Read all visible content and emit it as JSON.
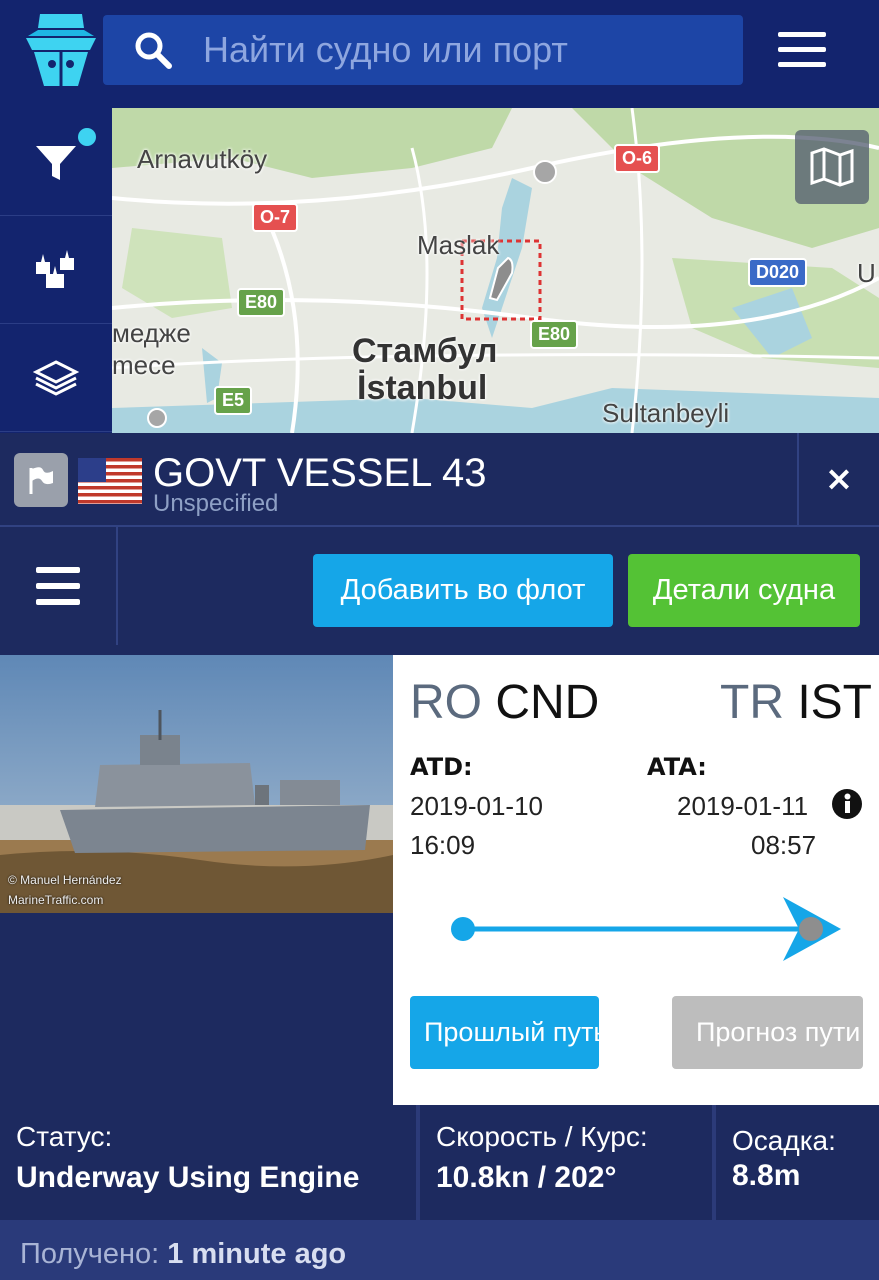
{
  "header": {
    "search_placeholder": "Найти судно или порт"
  },
  "map": {
    "labels": {
      "arnavutkoy": "Arnavutköy",
      "maslak": "Maslak",
      "istanbul_ru": "Стамбул",
      "istanbul": "İstanbul",
      "medzhe": "медже",
      "mece": "mece",
      "sultanbeyli": "Sultanbeyli",
      "u": "U"
    },
    "road_shields": {
      "o6a": "O-6",
      "o6b": "O-6",
      "o7": "O-7",
      "e80a": "E80",
      "e80b": "E80",
      "e5": "E5",
      "d020": "D020"
    }
  },
  "vessel": {
    "name": "GOVT VESSEL 43",
    "type": "Unspecified",
    "close": "×"
  },
  "actions": {
    "add_to_fleet": "Добавить во флот",
    "vessel_details": "Детали судна"
  },
  "photo": {
    "credit1": "© Manuel Hernández",
    "credit2": "MarineTraffic.com"
  },
  "voyage": {
    "origin_country": "RO",
    "origin_port": "CND",
    "dest_country": "TR",
    "dest_port": "IST",
    "atd_label": "ATD:",
    "atd_date": "2019-01-10",
    "atd_time": "16:09",
    "ata_label": "ATA:",
    "ata_date": "2019-01-11",
    "ata_time": "08:57",
    "past_track": "Прошлый путь",
    "forecast": "Прогноз пути"
  },
  "stats": {
    "status_label": "Статус:",
    "status_value": "Underway Using Engine",
    "speed_label": "Скорость / Курс:",
    "speed_value": "10.8kn / 202°",
    "draught_label": "Осадка:",
    "draught_value": "8.8m"
  },
  "footer": {
    "received_label": "Получено:",
    "received_value": "1 minute ago"
  },
  "colors": {
    "topbar": "#13246e",
    "panel": "#1d2a5f",
    "accent_blue": "#15a6e8",
    "accent_green": "#54c235"
  }
}
